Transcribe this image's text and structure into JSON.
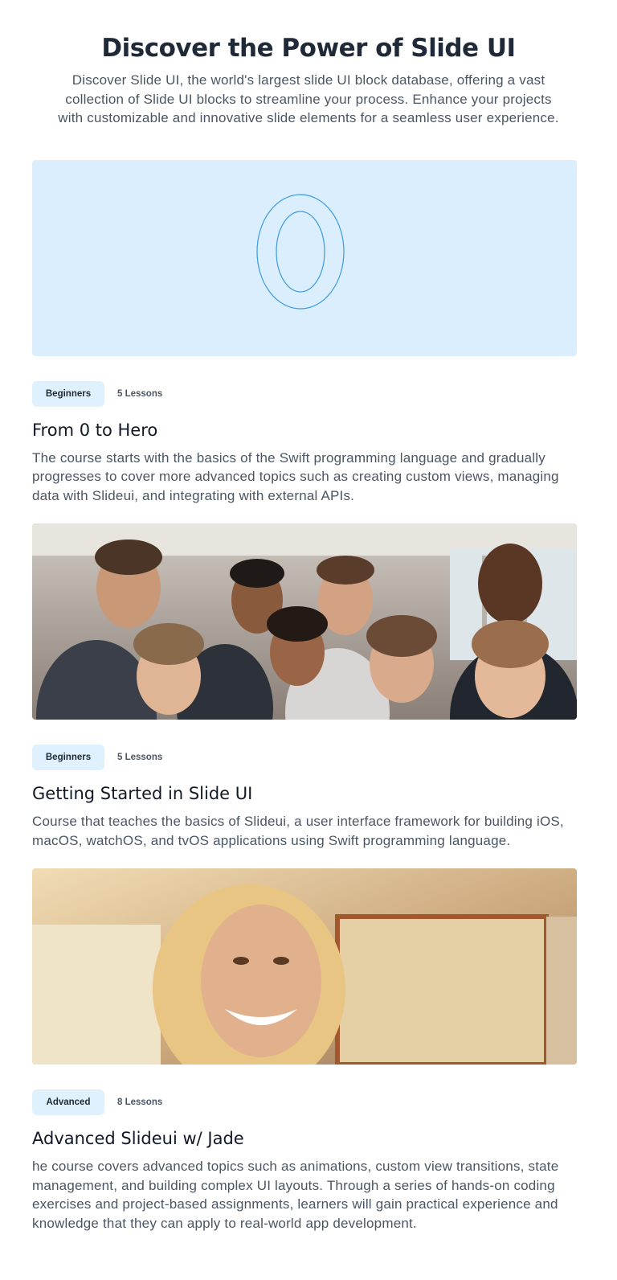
{
  "hero": {
    "title": "Discover the Power of Slide UI",
    "subtitle": "Discover Slide UI, the world's largest slide UI block database, offering a vast collection of Slide UI blocks to streamline your process. Enhance your projects with customizable and innovative slide elements for a seamless user experience."
  },
  "courses": [
    {
      "badge": "Beginners",
      "lessons": "5 Lessons",
      "title": "From 0 to Hero",
      "description": "The course starts with the basics of the Swift programming language and gradually progresses to cover more advanced topics such as creating custom views, managing data with Slideui, and integrating with external APIs.",
      "image_icon": "zero-glyph",
      "thumb_color": "#dbeefe",
      "glyph_color": "#3b9ae0"
    },
    {
      "badge": "Beginners",
      "lessons": "5 Lessons",
      "title": "Getting Started in Slide UI",
      "description": "Course that teaches the basics of Slideui, a user interface framework for building iOS, macOS, watchOS, and tvOS applications using Swift programming language.",
      "image_icon": "team-photo"
    },
    {
      "badge": "Advanced",
      "lessons": "8 Lessons",
      "title": "Advanced Slideui w/ Jade",
      "description": "he course covers advanced topics such as animations, custom view transitions, state management, and building complex UI layouts. Through a series of hands-on coding exercises and project-based assignments, learners will gain practical experience and knowledge that they can apply to real-world app development.",
      "image_icon": "portrait-photo"
    }
  ],
  "colors": {
    "badge_bg": "#e0f1fe",
    "heading": "#1f2937",
    "body_text": "#4b5563"
  }
}
